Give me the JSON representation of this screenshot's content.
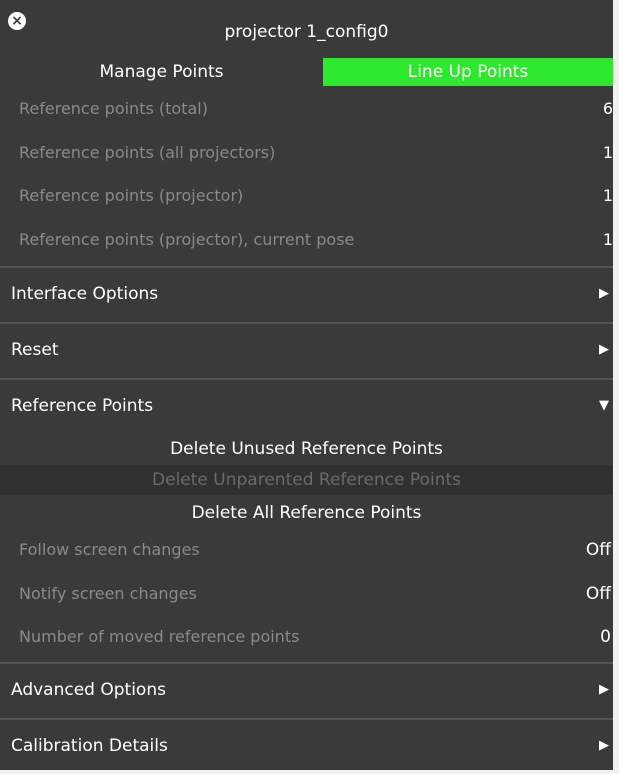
{
  "window": {
    "title": "projector 1_config0",
    "close_glyph": "×"
  },
  "tabs": [
    {
      "label": "Manage Points",
      "active": false
    },
    {
      "label": "Line Up Points",
      "active": true,
      "color": "#2ee82e"
    }
  ],
  "stats": [
    {
      "label": "Reference points (total)",
      "value": "6"
    },
    {
      "label": "Reference points (all projectors)",
      "value": "1"
    },
    {
      "label": "Reference points (projector)",
      "value": "1"
    },
    {
      "label": "Reference points (projector), current pose",
      "value": "1"
    }
  ],
  "sections": {
    "interface_options": {
      "label": "Interface Options",
      "arrow": "▶",
      "expanded": false
    },
    "reset": {
      "label": "Reset",
      "arrow": "▶",
      "expanded": false
    },
    "reference_points": {
      "label": "Reference Points",
      "arrow": "▼",
      "expanded": true
    },
    "advanced_options": {
      "label": "Advanced Options",
      "arrow": "▶",
      "expanded": false
    },
    "calibration_details": {
      "label": "Calibration Details",
      "arrow": "▶",
      "expanded": false
    }
  },
  "reference_points": {
    "delete_unused": "Delete Unused Reference Points",
    "delete_unparented": "Delete Unparented Reference Points",
    "delete_all": "Delete All Reference Points",
    "options": [
      {
        "label": "Follow screen changes",
        "value": "Off"
      },
      {
        "label": "Notify screen changes",
        "value": "Off"
      },
      {
        "label": "Number of moved reference points",
        "value": "0"
      }
    ]
  },
  "colors": {
    "panel_bg": "#3a3a3a",
    "accent_green": "#2ee82e",
    "dim_text": "#8a8a8a"
  }
}
